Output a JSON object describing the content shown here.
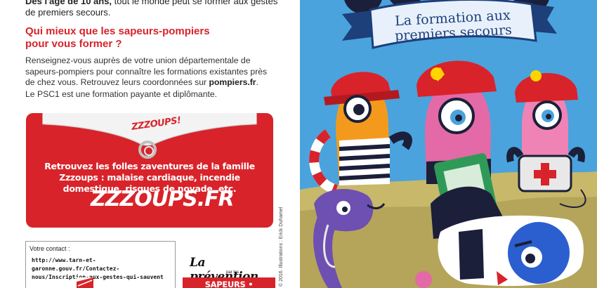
{
  "intro": {
    "bold": "Dès l'âge de 10 ans,",
    "rest": " tout le monde peut se former aux gestes de premiers secours."
  },
  "question": {
    "line1": "Qui mieux que les sapeurs-pompiers",
    "line2": "pour vous former ?"
  },
  "paragraph": {
    "text": "Renseignez-vous auprès de votre union départementale de sapeurs-pompiers pour connaître les formations existantes près de chez vous. Retrouvez leurs coordonnées sur ",
    "site": "pompiers.fr",
    "end": "."
  },
  "paragraph2": "Le PSC1 est une formation payante et diplômante.",
  "banner": {
    "small_logo": "ZZZOUPS!",
    "text": "Retrouvez les folles zaventures de la famille Zzzoups : malaise cardiaque, incendie domestique, risques de noyade, etc.",
    "site": "ZZZOUPS.FR"
  },
  "contact": {
    "label": "Votre contact :",
    "url": "http://www.tarn-et-garonne.gouv.fr/Contactez-nous/Inscription-aux-gestes-qui-sauvent"
  },
  "prevention": {
    "title": "La prévention",
    "par": "par les",
    "band": "SAPEURS • POMPIERS"
  },
  "credit": "© 2016. Illustrations : Erick Duhamel",
  "cover": {
    "title_line1": "La formation aux",
    "title_line2": "premiers secours"
  },
  "colors": {
    "red": "#d8232a",
    "sky": "#4aa3dc",
    "navy": "#1d3f7a"
  }
}
